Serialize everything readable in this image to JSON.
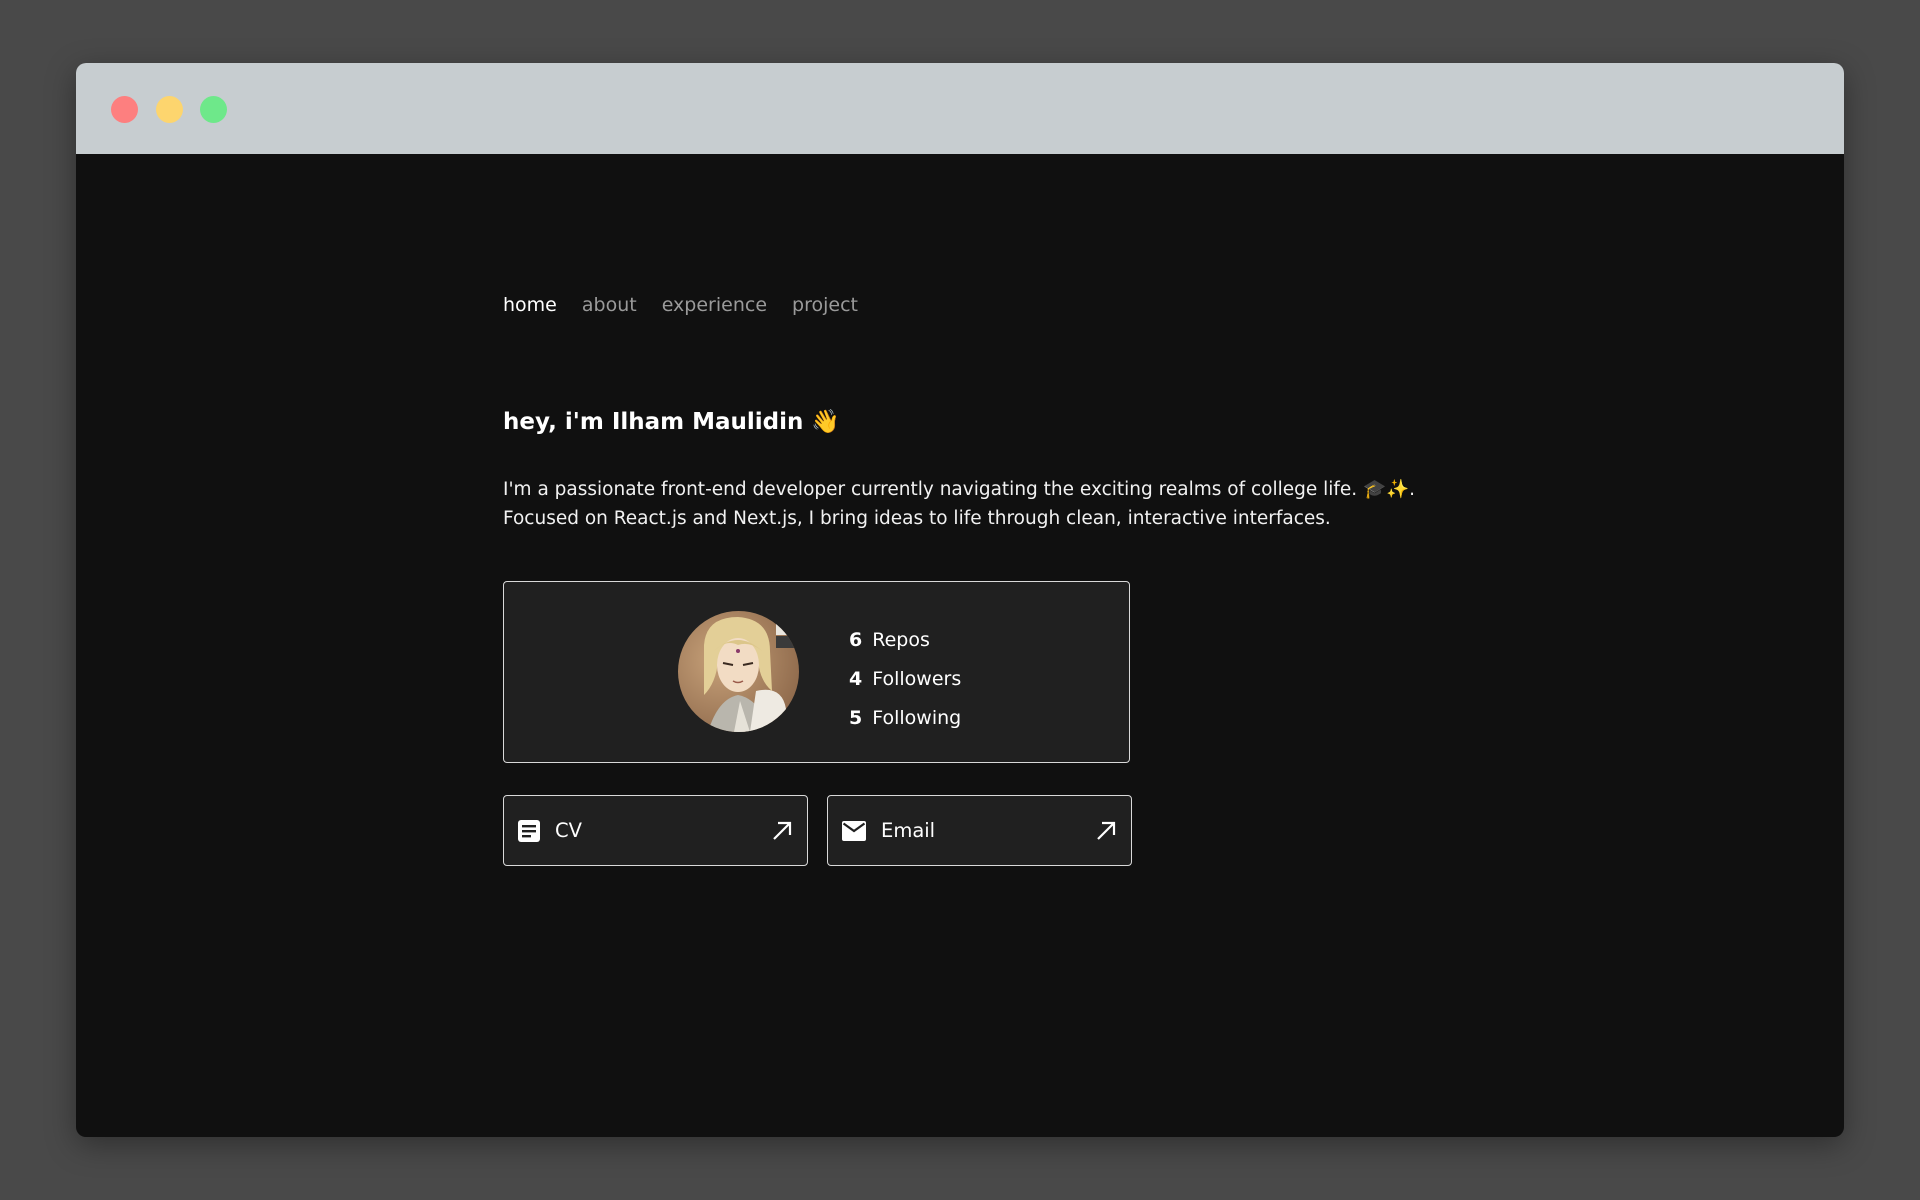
{
  "nav": {
    "items": [
      {
        "label": "home",
        "active": true
      },
      {
        "label": "about",
        "active": false
      },
      {
        "label": "experience",
        "active": false
      },
      {
        "label": "project",
        "active": false
      }
    ]
  },
  "hero": {
    "greeting": "hey, i'm Ilham Maulidin 👋",
    "bio_line1": "I'm a passionate front-end developer currently navigating the exciting realms of college life. 🎓✨.",
    "bio_line2": "Focused on React.js and Next.js, I bring ideas to life through clean, interactive interfaces."
  },
  "profile": {
    "stats": [
      {
        "value": "6",
        "label": "Repos"
      },
      {
        "value": "4",
        "label": "Followers"
      },
      {
        "value": "5",
        "label": "Following"
      }
    ]
  },
  "links": {
    "cv": {
      "label": "CV",
      "icon": "document-icon"
    },
    "email": {
      "label": "Email",
      "icon": "mail-icon"
    }
  },
  "colors": {
    "background": "#101010",
    "card": "#202020",
    "titlebar": "#c7cdd0",
    "close": "#fd7f7f",
    "minimize": "#fdd56e",
    "maximize": "#6ee88a"
  }
}
